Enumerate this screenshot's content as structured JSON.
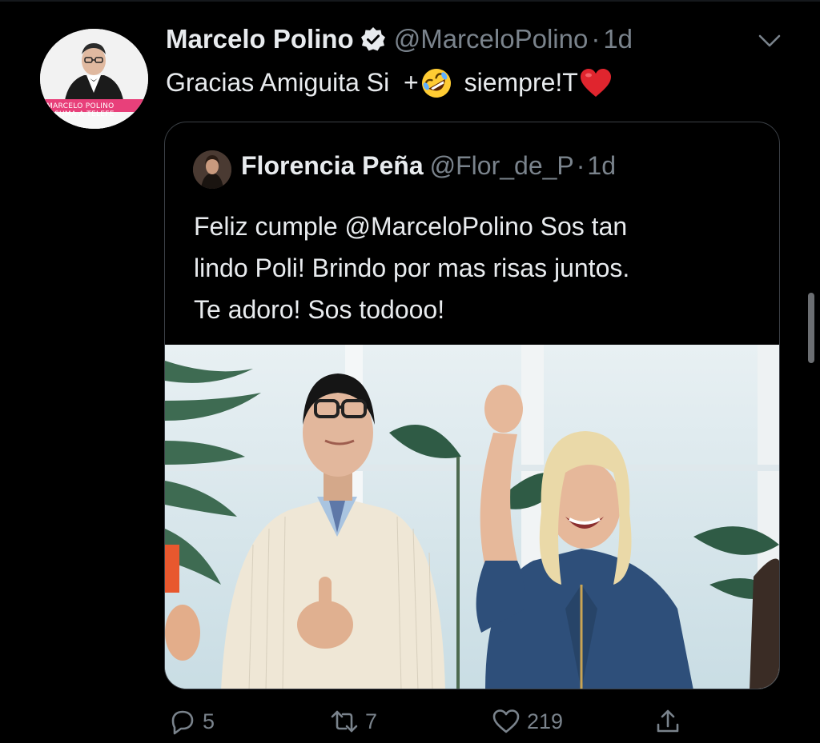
{
  "tweet": {
    "display_name": "Marcelo Polino",
    "handle": "@MarceloPolino",
    "separator": "·",
    "time": "1d",
    "avatar_caption_line1": "MARCELO POLINO",
    "avatar_caption_line2": "SUMA A TELEFE",
    "text_before": "Gracias Amiguita Si  +",
    "text_middle": " siempre!T",
    "emoji": [
      "rolling-on-floor-laughing",
      "red-heart"
    ]
  },
  "quote": {
    "display_name": "Florencia Peña",
    "handle": "@Flor_de_P",
    "separator": "·",
    "time": "1d",
    "text_lines": [
      "Feliz cumple @MarceloPolino Sos tan",
      "lindo Poli! Brindo por mas risas juntos.",
      "Te adoro! Sos todooo!"
    ]
  },
  "actions": {
    "reply_count": "5",
    "retweet_count": "7",
    "like_count": "219",
    "reply_icon": "reply-icon",
    "retweet_icon": "retweet-icon",
    "like_icon": "heart-icon",
    "share_icon": "share-icon"
  },
  "colors": {
    "background": "#000000",
    "primary_text": "#e8ebee",
    "secondary_text": "#7a838c",
    "border": "#3b4046"
  }
}
